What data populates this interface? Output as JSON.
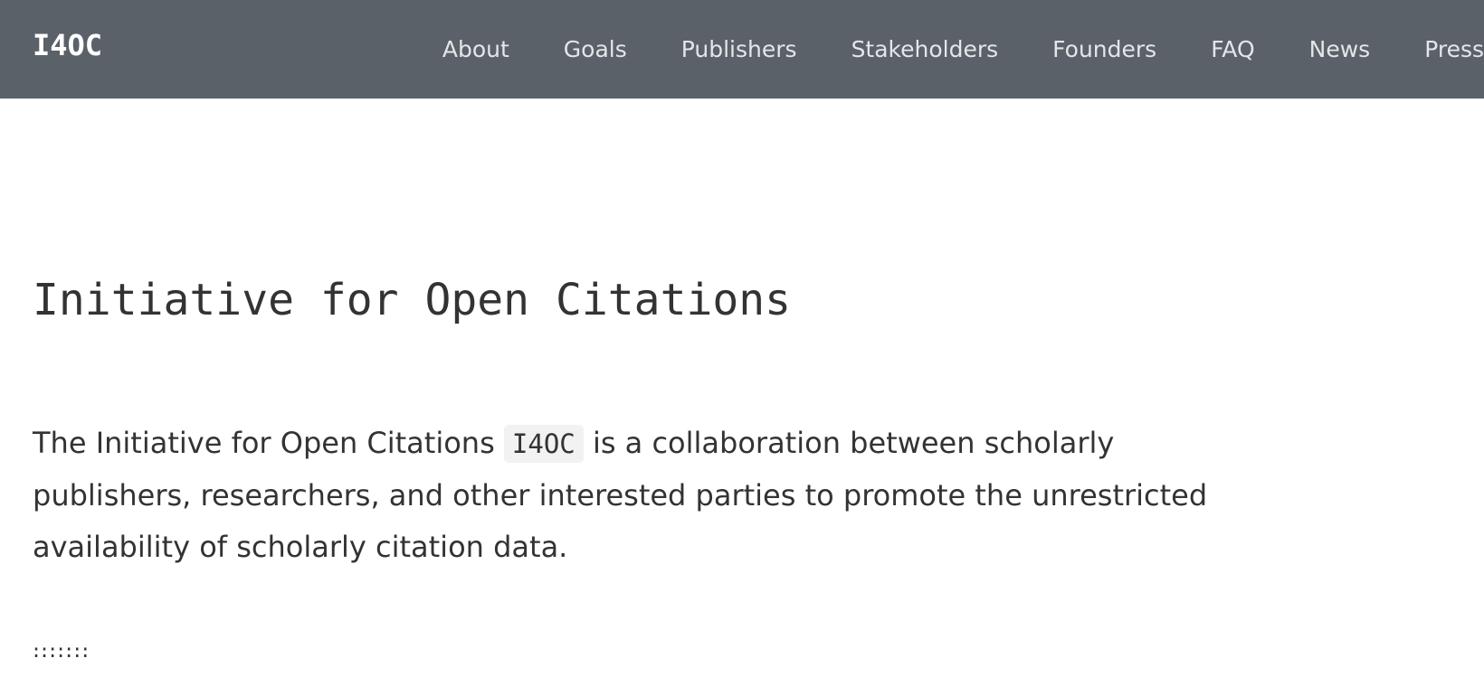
{
  "header": {
    "brand": "I4OC",
    "background_color": "#5a6169",
    "nav_items": [
      {
        "label": "About"
      },
      {
        "label": "Goals"
      },
      {
        "label": "Publishers"
      },
      {
        "label": "Stakeholders"
      },
      {
        "label": "Founders"
      },
      {
        "label": "FAQ"
      },
      {
        "label": "News"
      },
      {
        "label": "Press"
      }
    ]
  },
  "main": {
    "title": "Initiative for Open Citations",
    "intro": {
      "before": "The Initiative for Open Citations",
      "code": "I4OC",
      "after": "is a collaboration between scholarly publishers, researchers, and other interested parties to promote the unrestricted availability of scholarly citation data."
    },
    "separator": ":::::::"
  }
}
